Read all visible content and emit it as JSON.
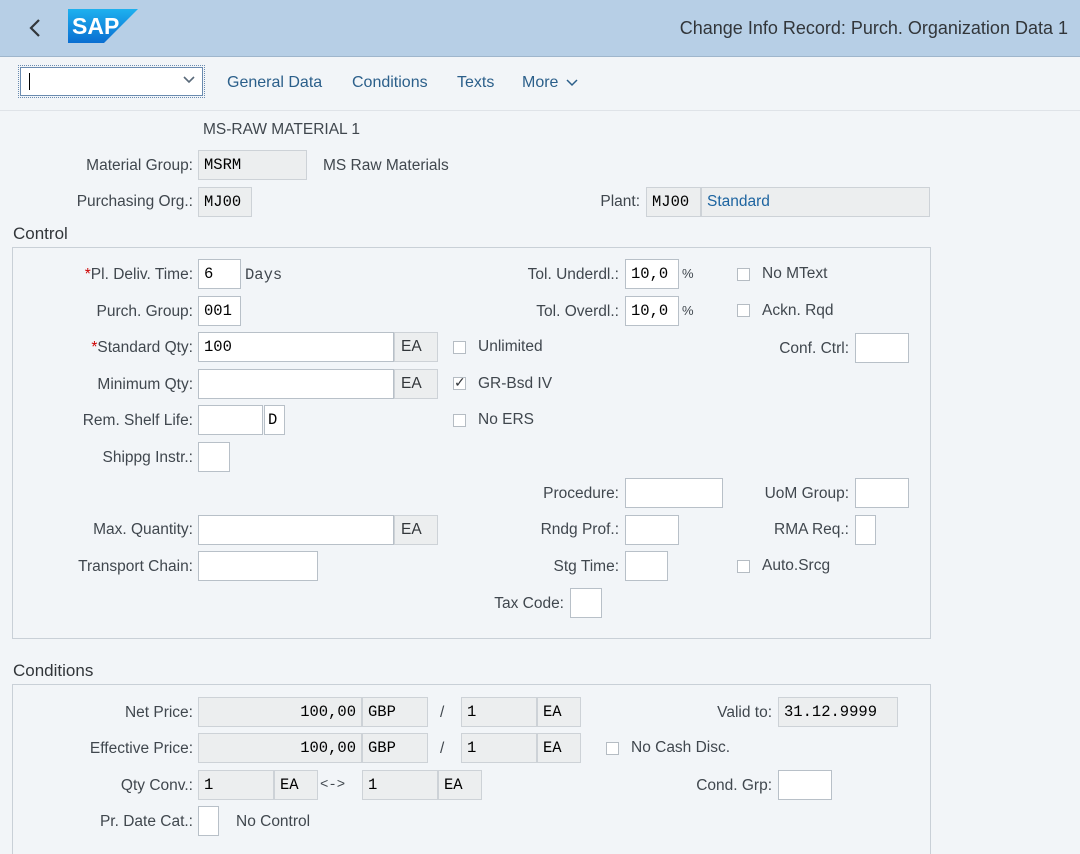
{
  "header": {
    "title": "Change Info Record: Purch. Organization Data 1",
    "logo": "SAP"
  },
  "toolbar": {
    "dropdown_value": "",
    "tabs": [
      "General Data",
      "Conditions",
      "Texts",
      "More"
    ]
  },
  "material": {
    "description": "MS-RAW MATERIAL 1",
    "material_group_label": "Material Group:",
    "material_group_value": "MSRM",
    "material_group_text": "MS Raw Materials",
    "purch_org_label": "Purchasing Org.:",
    "purch_org_value": "MJ00",
    "plant_label": "Plant:",
    "plant_value": "MJ00",
    "plant_text": "Standard"
  },
  "control": {
    "title": "Control",
    "pl_deliv_time": {
      "label": "Pl. Deliv. Time:",
      "value": "6",
      "unit": "Days"
    },
    "purch_group": {
      "label": "Purch. Group:",
      "value": "001"
    },
    "standard_qty": {
      "label": "Standard Qty:",
      "value": "100",
      "unit": "EA"
    },
    "minimum_qty": {
      "label": "Minimum Qty:",
      "value": "",
      "unit": "EA"
    },
    "rem_shelf_life": {
      "label": "Rem. Shelf Life:",
      "value": "",
      "unit": "D"
    },
    "shippg_instr": {
      "label": "Shippg Instr.:",
      "value": ""
    },
    "max_quantity": {
      "label": "Max. Quantity:",
      "value": "",
      "unit": "EA"
    },
    "transport_chain": {
      "label": "Transport Chain:",
      "value": ""
    },
    "tol_underdl": {
      "label": "Tol. Underdl.:",
      "value": "10,0",
      "unit": "%"
    },
    "tol_overdl": {
      "label": "Tol. Overdl.:",
      "value": "10,0",
      "unit": "%"
    },
    "unlimited": {
      "label": "Unlimited",
      "checked": false
    },
    "gr_bsd_iv": {
      "label": "GR-Bsd IV",
      "checked": true
    },
    "no_ers": {
      "label": "No ERS",
      "checked": false
    },
    "no_mtext": {
      "label": "No MText",
      "checked": false
    },
    "ackn_rqd": {
      "label": "Ackn. Rqd",
      "checked": false
    },
    "conf_ctrl": {
      "label": "Conf. Ctrl:",
      "value": ""
    },
    "procedure": {
      "label": "Procedure:",
      "value": ""
    },
    "uom_group": {
      "label": "UoM Group:",
      "value": ""
    },
    "rndg_prof": {
      "label": "Rndg Prof.:",
      "value": ""
    },
    "rma_req": {
      "label": "RMA Req.:",
      "value": ""
    },
    "stg_time": {
      "label": "Stg Time:",
      "value": ""
    },
    "auto_srcg": {
      "label": "Auto.Srcg",
      "checked": false
    },
    "tax_code": {
      "label": "Tax Code:",
      "value": ""
    }
  },
  "conditions": {
    "title": "Conditions",
    "net_price": {
      "label": "Net Price:",
      "value": "100,00",
      "currency": "GBP",
      "slash": "/",
      "per": "1",
      "unit": "EA"
    },
    "effective_price": {
      "label": "Effective Price:",
      "value": "100,00",
      "currency": "GBP",
      "slash": "/",
      "per": "1",
      "unit": "EA"
    },
    "qty_conv": {
      "label": "Qty Conv.:",
      "value1": "1",
      "unit1": "EA",
      "arrow": "<->",
      "value2": "1",
      "unit2": "EA"
    },
    "pr_date_cat": {
      "label": "Pr. Date Cat.:",
      "value": "",
      "text": "No Control"
    },
    "valid_to": {
      "label": "Valid to:",
      "value": "31.12.9999"
    },
    "no_cash_disc": {
      "label": "No Cash Disc.",
      "checked": false
    },
    "cond_grp": {
      "label": "Cond. Grp:",
      "value": ""
    }
  },
  "icons": {
    "back": "back-chevron-icon",
    "dropdown": "chevron-down-icon"
  }
}
